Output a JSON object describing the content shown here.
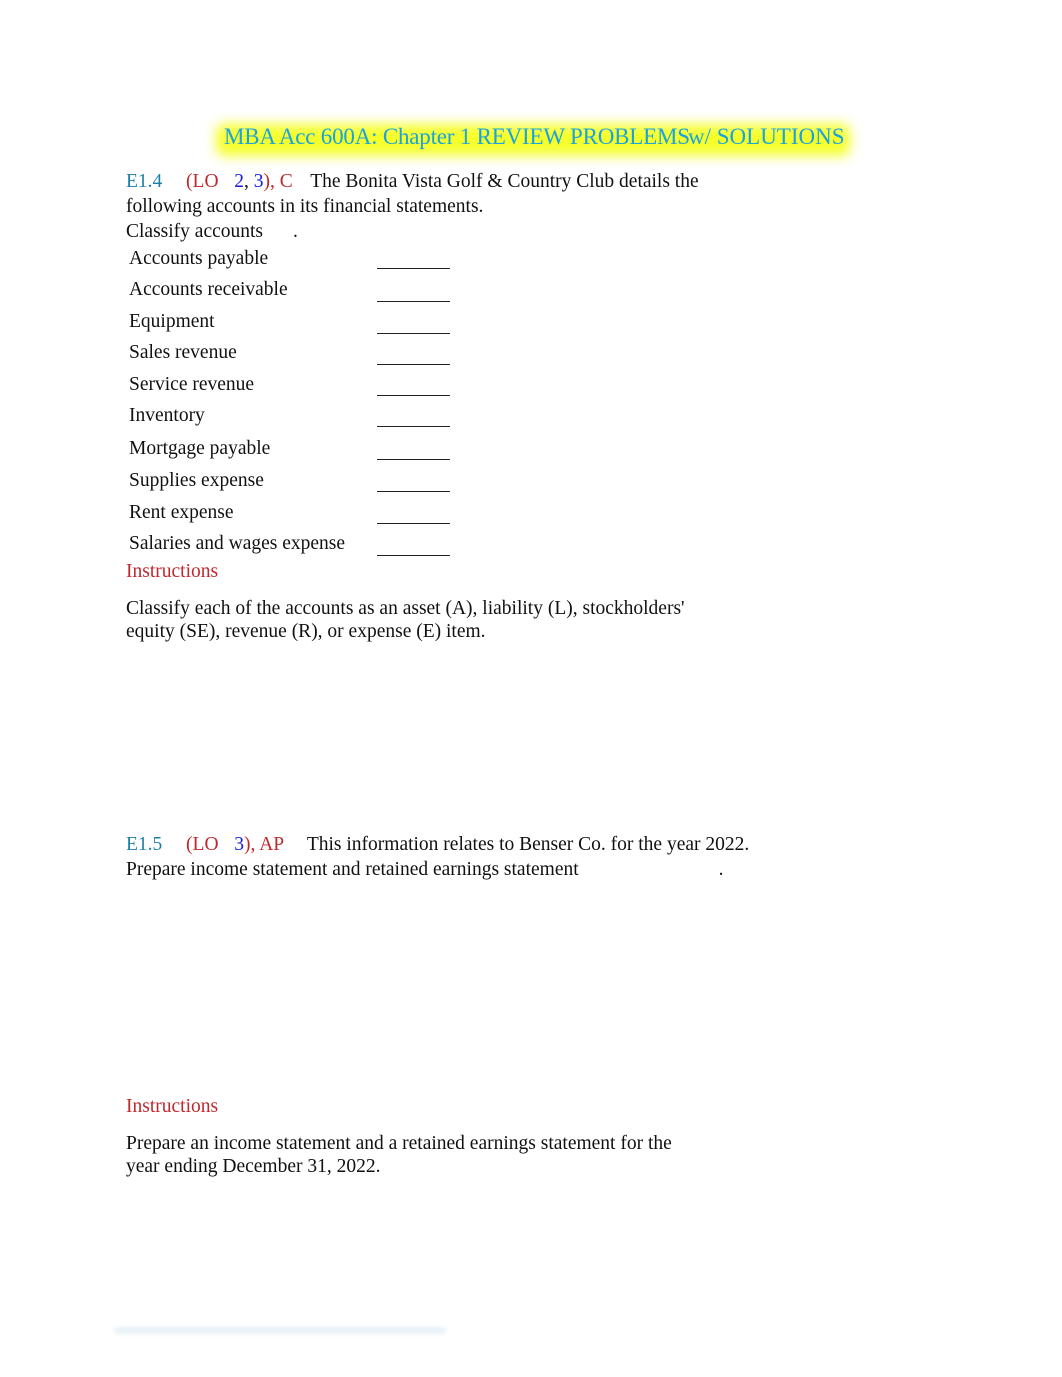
{
  "document": {
    "title": "MBA Acc 600A: Chapter 1 REVIEW PROBLEMS",
    "title_overlap": "w/ SOLUTIONS"
  },
  "colors": {
    "title": "#1aa3df",
    "title_highlight": "#f5ff2a",
    "exercise_code": "#1a7fa8",
    "lo_red": "#c0282d",
    "lo_blue": "#1c1ce6",
    "body": "#111111"
  },
  "e14": {
    "code": "E1.4",
    "lo_open": "(LO",
    "lo_1": "2",
    "lo_sep": ",",
    "lo_2": "3",
    "lo_close": "), C",
    "intro_line1": "The Bonita Vista Golf & Country Club details the",
    "intro_line2": "following accounts in its financial statements.",
    "task": "Classify accounts",
    "task_end": ".",
    "accounts": [
      {
        "name": "Accounts payable",
        "answer": ""
      },
      {
        "name": "Accounts receivable",
        "answer": ""
      },
      {
        "name": "Equipment",
        "answer": ""
      },
      {
        "name": "Sales revenue",
        "answer": ""
      },
      {
        "name": "Service revenue",
        "answer": ""
      },
      {
        "name": "Inventory",
        "answer": ""
      },
      {
        "name": "Mortgage payable",
        "answer": ""
      },
      {
        "name": "Supplies expense",
        "answer": ""
      },
      {
        "name": "Rent expense",
        "answer": ""
      },
      {
        "name": "Salaries and wages expense",
        "answer": ""
      }
    ],
    "instructions_label": "Instructions",
    "instructions_line1": "Classify each of the accounts as an asset (A), liability (L), stockholders'",
    "instructions_line2": "equity (SE), revenue (R), or expense (E) item."
  },
  "e15": {
    "code": "E1.5",
    "lo_open": "(LO",
    "lo_1": "3",
    "lo_close": "), AP",
    "intro_line1": "This information relates to Benser Co. for the year 2022.",
    "task": "Prepare income statement and retained earnings statement",
    "task_end": ".",
    "instructions_label": "Instructions",
    "instructions_line1": "Prepare an income statement and a retained earnings statement for the",
    "instructions_line2": "year ending December 31, 2022."
  }
}
